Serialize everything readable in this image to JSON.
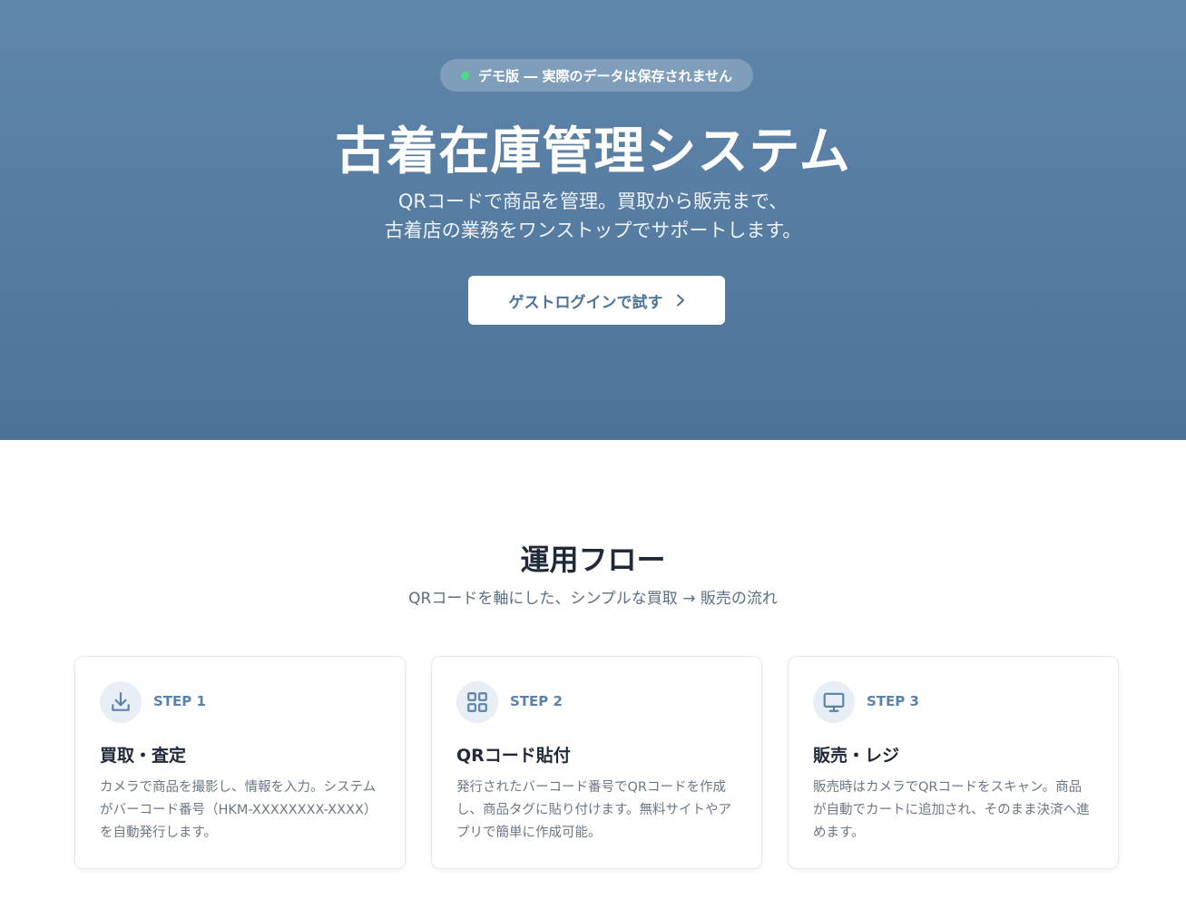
{
  "hero": {
    "badge_text": "デモ版 ― 実際のデータは保存されません",
    "title": "古着在庫管理システム",
    "subtitle_line1": "QRコードで商品を管理。買取から販売まで、",
    "subtitle_line2": "古着店の業務をワンストップでサポートします。",
    "cta_label": "ゲストログインで試す"
  },
  "flow": {
    "title": "運用フロー",
    "subtitle": "QRコードを軸にした、シンプルな買取 → 販売の流れ",
    "steps": [
      {
        "step_label": "STEP 1",
        "title": "買取・査定",
        "description": "カメラで商品を撮影し、情報を入力。システムがバーコード番号（HKM-XXXXXXXX-XXXX）を自動発行します。",
        "icon": "download-icon"
      },
      {
        "step_label": "STEP 2",
        "title": "QRコード貼付",
        "description": "発行されたバーコード番号でQRコードを作成し、商品タグに貼り付けます。無料サイトやアプリで簡単に作成可能。",
        "icon": "grid-icon"
      },
      {
        "step_label": "STEP 3",
        "title": "販売・レジ",
        "description": "販売時はカメラでQRコードをスキャン。商品が自動でカートに追加され、そのまま決済へ進めます。",
        "icon": "monitor-icon"
      }
    ]
  },
  "colors": {
    "hero_top": "#5f86ab",
    "hero_bottom": "#4e7398",
    "accent": "#5b82aa",
    "status_dot": "#4ade80"
  }
}
